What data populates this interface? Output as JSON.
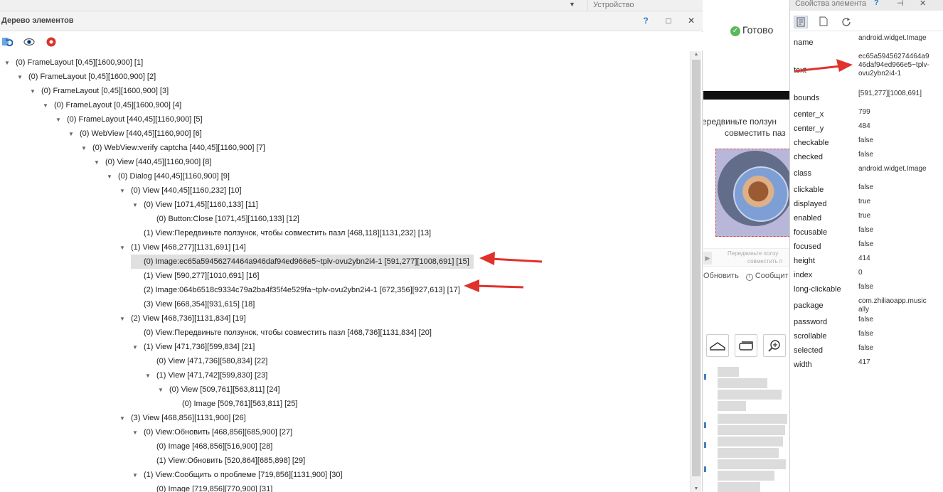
{
  "top_strip": {
    "device_label": "Устройство"
  },
  "tree": {
    "title": "Дерево элементов",
    "help": "?",
    "max": "□",
    "close": "✕",
    "nodes": [
      {
        "text": "(0) FrameLayout [0,45][1600,900] [1]",
        "depth": 0,
        "toggle": "▼",
        "selected": false
      },
      {
        "text": "(0) FrameLayout [0,45][1600,900] [2]",
        "depth": 1,
        "toggle": "▼",
        "selected": false
      },
      {
        "text": "(0) FrameLayout [0,45][1600,900] [3]",
        "depth": 2,
        "toggle": "▼",
        "selected": false
      },
      {
        "text": "(0) FrameLayout [0,45][1600,900] [4]",
        "depth": 3,
        "toggle": "▼",
        "selected": false
      },
      {
        "text": "(0) FrameLayout [440,45][1160,900] [5]",
        "depth": 4,
        "toggle": "▼",
        "selected": false
      },
      {
        "text": "(0) WebView [440,45][1160,900] [6]",
        "depth": 5,
        "toggle": "▼",
        "selected": false
      },
      {
        "text": "(0) WebView:verify captcha [440,45][1160,900] [7]",
        "depth": 6,
        "toggle": "▼",
        "selected": false
      },
      {
        "text": "(0) View [440,45][1160,900] [8]",
        "depth": 7,
        "toggle": "▼",
        "selected": false
      },
      {
        "text": "(0) Dialog [440,45][1160,900] [9]",
        "depth": 8,
        "toggle": "▼",
        "selected": false
      },
      {
        "text": "(0) View [440,45][1160,232] [10]",
        "depth": 9,
        "toggle": "▼",
        "selected": false
      },
      {
        "text": "(0) View [1071,45][1160,133] [11]",
        "depth": 10,
        "toggle": "▼",
        "selected": false
      },
      {
        "text": "(0) Button:Close [1071,45][1160,133] [12]",
        "depth": 11,
        "toggle": "",
        "selected": false
      },
      {
        "text": "(1) View:Передвиньте ползунок, чтобы совместить пазл [468,118][1131,232] [13]",
        "depth": 10,
        "toggle": "",
        "selected": false
      },
      {
        "text": "(1) View [468,277][1131,691] [14]",
        "depth": 9,
        "toggle": "▼",
        "selected": false
      },
      {
        "text": "(0) Image:ec65a59456274464a946daf94ed966e5~tplv-ovu2ybn2i4-1 [591,277][1008,691] [15]",
        "depth": 10,
        "toggle": "",
        "selected": true
      },
      {
        "text": "(1) View [590,277][1010,691] [16]",
        "depth": 10,
        "toggle": "",
        "selected": false
      },
      {
        "text": "(2) Image:064b6518c9334c79a2ba4f35f4e529fa~tplv-ovu2ybn2i4-1 [672,356][927,613] [17]",
        "depth": 10,
        "toggle": "",
        "selected": false
      },
      {
        "text": "(3) View [668,354][931,615] [18]",
        "depth": 10,
        "toggle": "",
        "selected": false
      },
      {
        "text": "(2) View [468,736][1131,834] [19]",
        "depth": 9,
        "toggle": "▼",
        "selected": false
      },
      {
        "text": "(0) View:Передвиньте ползунок, чтобы совместить пазл [468,736][1131,834] [20]",
        "depth": 10,
        "toggle": "",
        "selected": false
      },
      {
        "text": "(1) View [471,736][599,834] [21]",
        "depth": 10,
        "toggle": "▼",
        "selected": false
      },
      {
        "text": "(0) View [471,736][580,834] [22]",
        "depth": 11,
        "toggle": "",
        "selected": false
      },
      {
        "text": "(1) View [471,742][599,830] [23]",
        "depth": 11,
        "toggle": "▼",
        "selected": false
      },
      {
        "text": "(0) View [509,761][563,811] [24]",
        "depth": 12,
        "toggle": "▼",
        "selected": false
      },
      {
        "text": "(0) Image [509,761][563,811] [25]",
        "depth": 13,
        "toggle": "",
        "selected": false
      },
      {
        "text": "(3) View [468,856][1131,900] [26]",
        "depth": 9,
        "toggle": "▼",
        "selected": false
      },
      {
        "text": "(0) View:Обновить [468,856][685,900] [27]",
        "depth": 10,
        "toggle": "▼",
        "selected": false
      },
      {
        "text": "(0) Image [468,856][516,900] [28]",
        "depth": 11,
        "toggle": "",
        "selected": false
      },
      {
        "text": "(1) View:Обновить [520,864][685,898] [29]",
        "depth": 11,
        "toggle": "",
        "selected": false
      },
      {
        "text": "(1) View:Сообщить о проблеме [719,856][1131,900] [30]",
        "depth": 10,
        "toggle": "▼",
        "selected": false
      },
      {
        "text": "(0) Image [719,856][770,900] [31]",
        "depth": 11,
        "toggle": "",
        "selected": false
      }
    ]
  },
  "device": {
    "ready": "Готово",
    "caption_line1": "ередвиньте ползун",
    "caption_line2": "совместить паз",
    "slider_hint1": "Передвиньте ползу",
    "slider_hint2": "совместить п",
    "refresh": "Обновить",
    "report": "Сообщит"
  },
  "props": {
    "title": "Свойства элемента",
    "help": "?",
    "pin": "⊣",
    "close": "✕",
    "rows": [
      {
        "key": "name",
        "value": "android.widget.Image"
      },
      {
        "key": "text",
        "value": "ec65a59456274464a946daf94ed966e5~tplv-ovu2ybn2i4-1"
      },
      {
        "key": "bounds",
        "value": "[591,277][1008,691]"
      },
      {
        "key": "center_x",
        "value": "799"
      },
      {
        "key": "center_y",
        "value": "484"
      },
      {
        "key": "checkable",
        "value": "false"
      },
      {
        "key": "checked",
        "value": "false"
      },
      {
        "key": "class",
        "value": "android.widget.Image"
      },
      {
        "key": "clickable",
        "value": "false"
      },
      {
        "key": "displayed",
        "value": "true"
      },
      {
        "key": "enabled",
        "value": "true"
      },
      {
        "key": "focusable",
        "value": "false"
      },
      {
        "key": "focused",
        "value": "false"
      },
      {
        "key": "height",
        "value": "414"
      },
      {
        "key": "index",
        "value": "0"
      },
      {
        "key": "long-clickable",
        "value": "false"
      },
      {
        "key": "package",
        "value": "com.zhiliaoapp.musically"
      },
      {
        "key": "password",
        "value": "false"
      },
      {
        "key": "scrollable",
        "value": "false"
      },
      {
        "key": "selected",
        "value": "false"
      },
      {
        "key": "width",
        "value": "417"
      }
    ]
  },
  "colors": {
    "arrow": "#e0312b",
    "ready_check": "#5cb85c",
    "selection": "#e0e0e0"
  }
}
